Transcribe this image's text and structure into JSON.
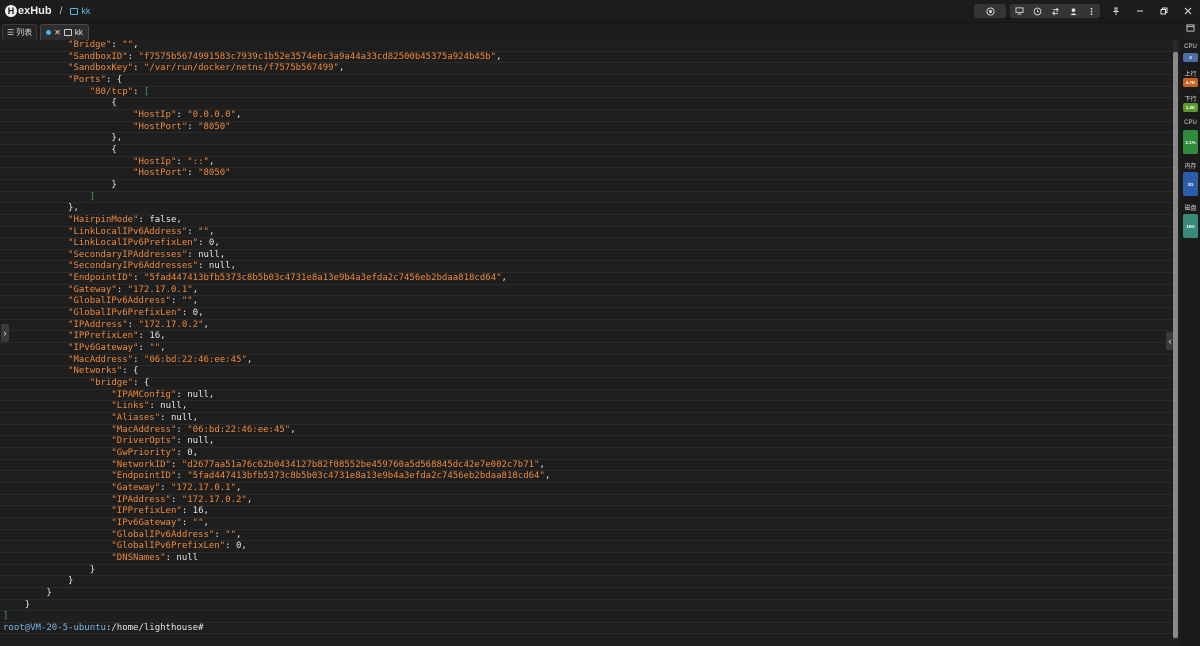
{
  "app": {
    "logo_letter": "H",
    "title": "exHub",
    "breadcrumb_sep": "/",
    "breadcrumb_item": "kk"
  },
  "tabs": {
    "list_label": "列表",
    "active_close": "✕",
    "active_label": "kk"
  },
  "terminal_lines": [
    {
      "indent": 12,
      "segs": [
        [
          "k",
          "\"Bridge\""
        ],
        [
          "p",
          ": "
        ],
        [
          "s",
          "\"\""
        ],
        [
          "p",
          ","
        ]
      ]
    },
    {
      "indent": 12,
      "segs": [
        [
          "k",
          "\"SandboxID\""
        ],
        [
          "p",
          ": "
        ],
        [
          "s",
          "\"f7575b5674991583c7939c1b52e3574ebc3a9a44a33cd82500b45375a924b45b\""
        ],
        [
          "p",
          ","
        ]
      ]
    },
    {
      "indent": 12,
      "segs": [
        [
          "k",
          "\"SandboxKey\""
        ],
        [
          "p",
          ": "
        ],
        [
          "s",
          "\"/var/run/docker/netns/f7575b567499\""
        ],
        [
          "p",
          ","
        ]
      ]
    },
    {
      "indent": 12,
      "segs": [
        [
          "k",
          "\"Ports\""
        ],
        [
          "p",
          ": {"
        ]
      ]
    },
    {
      "indent": 16,
      "segs": [
        [
          "k",
          "\"80/tcp\""
        ],
        [
          "p",
          ": "
        ],
        [
          "g",
          "["
        ]
      ]
    },
    {
      "indent": 20,
      "segs": [
        [
          "p",
          "{"
        ]
      ]
    },
    {
      "indent": 24,
      "segs": [
        [
          "k",
          "\"HostIp\""
        ],
        [
          "p",
          ": "
        ],
        [
          "s",
          "\"0.0.0.0\""
        ],
        [
          "p",
          ","
        ]
      ]
    },
    {
      "indent": 24,
      "segs": [
        [
          "k",
          "\"HostPort\""
        ],
        [
          "p",
          ": "
        ],
        [
          "s",
          "\"8050\""
        ]
      ]
    },
    {
      "indent": 20,
      "segs": [
        [
          "p",
          "},"
        ]
      ]
    },
    {
      "indent": 20,
      "segs": [
        [
          "p",
          "{"
        ]
      ]
    },
    {
      "indent": 24,
      "segs": [
        [
          "k",
          "\"HostIp\""
        ],
        [
          "p",
          ": "
        ],
        [
          "s",
          "\"::\""
        ],
        [
          "p",
          ","
        ]
      ]
    },
    {
      "indent": 24,
      "segs": [
        [
          "k",
          "\"HostPort\""
        ],
        [
          "p",
          ": "
        ],
        [
          "s",
          "\"8050\""
        ]
      ]
    },
    {
      "indent": 20,
      "segs": [
        [
          "p",
          "}"
        ]
      ]
    },
    {
      "indent": 16,
      "segs": [
        [
          "g",
          "]"
        ]
      ]
    },
    {
      "indent": 12,
      "segs": [
        [
          "p",
          "},"
        ]
      ]
    },
    {
      "indent": 12,
      "segs": [
        [
          "k",
          "\"HairpinMode\""
        ],
        [
          "p",
          ": false,"
        ]
      ]
    },
    {
      "indent": 12,
      "segs": [
        [
          "k",
          "\"LinkLocalIPv6Address\""
        ],
        [
          "p",
          ": "
        ],
        [
          "s",
          "\"\""
        ],
        [
          "p",
          ","
        ]
      ]
    },
    {
      "indent": 12,
      "segs": [
        [
          "k",
          "\"LinkLocalIPv6PrefixLen\""
        ],
        [
          "p",
          ": 0,"
        ]
      ]
    },
    {
      "indent": 12,
      "segs": [
        [
          "k",
          "\"SecondaryIPAddresses\""
        ],
        [
          "p",
          ": null,"
        ]
      ]
    },
    {
      "indent": 12,
      "segs": [
        [
          "k",
          "\"SecondaryIPv6Addresses\""
        ],
        [
          "p",
          ": null,"
        ]
      ]
    },
    {
      "indent": 12,
      "segs": [
        [
          "k",
          "\"EndpointID\""
        ],
        [
          "p",
          ": "
        ],
        [
          "s",
          "\"5fad447413bfb5373c8b5b03c4731e8a13e9b4a3efda2c7456eb2bdaa818cd64\""
        ],
        [
          "p",
          ","
        ]
      ]
    },
    {
      "indent": 12,
      "segs": [
        [
          "k",
          "\"Gateway\""
        ],
        [
          "p",
          ": "
        ],
        [
          "s",
          "\"172.17.0.1\""
        ],
        [
          "p",
          ","
        ]
      ]
    },
    {
      "indent": 12,
      "segs": [
        [
          "k",
          "\"GlobalIPv6Address\""
        ],
        [
          "p",
          ": "
        ],
        [
          "s",
          "\"\""
        ],
        [
          "p",
          ","
        ]
      ]
    },
    {
      "indent": 12,
      "segs": [
        [
          "k",
          "\"GlobalIPv6PrefixLen\""
        ],
        [
          "p",
          ": 0,"
        ]
      ]
    },
    {
      "indent": 12,
      "segs": [
        [
          "k",
          "\"IPAddress\""
        ],
        [
          "p",
          ": "
        ],
        [
          "s",
          "\"172.17.0.2\""
        ],
        [
          "p",
          ","
        ]
      ]
    },
    {
      "indent": 12,
      "segs": [
        [
          "k",
          "\"IPPrefixLen\""
        ],
        [
          "p",
          ": 16,"
        ]
      ]
    },
    {
      "indent": 12,
      "segs": [
        [
          "k",
          "\"IPv6Gateway\""
        ],
        [
          "p",
          ": "
        ],
        [
          "s",
          "\"\""
        ],
        [
          "p",
          ","
        ]
      ]
    },
    {
      "indent": 12,
      "segs": [
        [
          "k",
          "\"MacAddress\""
        ],
        [
          "p",
          ": "
        ],
        [
          "s",
          "\"06:bd:22:46:ee:45\""
        ],
        [
          "p",
          ","
        ]
      ]
    },
    {
      "indent": 12,
      "segs": [
        [
          "k",
          "\"Networks\""
        ],
        [
          "p",
          ": {"
        ]
      ]
    },
    {
      "indent": 16,
      "segs": [
        [
          "k",
          "\"bridge\""
        ],
        [
          "p",
          ": {"
        ]
      ]
    },
    {
      "indent": 20,
      "segs": [
        [
          "k",
          "\"IPAMConfig\""
        ],
        [
          "p",
          ": null,"
        ]
      ]
    },
    {
      "indent": 20,
      "segs": [
        [
          "k",
          "\"Links\""
        ],
        [
          "p",
          ": null,"
        ]
      ]
    },
    {
      "indent": 20,
      "segs": [
        [
          "k",
          "\"Aliases\""
        ],
        [
          "p",
          ": null,"
        ]
      ]
    },
    {
      "indent": 20,
      "segs": [
        [
          "k",
          "\"MacAddress\""
        ],
        [
          "p",
          ": "
        ],
        [
          "s",
          "\"06:bd:22:46:ee:45\""
        ],
        [
          "p",
          ","
        ]
      ]
    },
    {
      "indent": 20,
      "segs": [
        [
          "k",
          "\"DriverOpts\""
        ],
        [
          "p",
          ": null,"
        ]
      ]
    },
    {
      "indent": 20,
      "segs": [
        [
          "k",
          "\"GwPriority\""
        ],
        [
          "p",
          ": 0,"
        ]
      ]
    },
    {
      "indent": 20,
      "segs": [
        [
          "k",
          "\"NetworkID\""
        ],
        [
          "p",
          ": "
        ],
        [
          "s",
          "\"d2677aa51a76c62b0434127b82f08552be459760a5d568845dc42e7e002c7b71\""
        ],
        [
          "p",
          ","
        ]
      ]
    },
    {
      "indent": 20,
      "segs": [
        [
          "k",
          "\"EndpointID\""
        ],
        [
          "p",
          ": "
        ],
        [
          "s",
          "\"5fad447413bfb5373c8b5b03c4731e8a13e9b4a3efda2c7456eb2bdaa818cd64\""
        ],
        [
          "p",
          ","
        ]
      ]
    },
    {
      "indent": 20,
      "segs": [
        [
          "k",
          "\"Gateway\""
        ],
        [
          "p",
          ": "
        ],
        [
          "s",
          "\"172.17.0.1\""
        ],
        [
          "p",
          ","
        ]
      ]
    },
    {
      "indent": 20,
      "segs": [
        [
          "k",
          "\"IPAddress\""
        ],
        [
          "p",
          ": "
        ],
        [
          "s",
          "\"172.17.0.2\""
        ],
        [
          "p",
          ","
        ]
      ]
    },
    {
      "indent": 20,
      "segs": [
        [
          "k",
          "\"IPPrefixLen\""
        ],
        [
          "p",
          ": 16,"
        ]
      ]
    },
    {
      "indent": 20,
      "segs": [
        [
          "k",
          "\"IPv6Gateway\""
        ],
        [
          "p",
          ": "
        ],
        [
          "s",
          "\"\""
        ],
        [
          "p",
          ","
        ]
      ]
    },
    {
      "indent": 20,
      "segs": [
        [
          "k",
          "\"GlobalIPv6Address\""
        ],
        [
          "p",
          ": "
        ],
        [
          "s",
          "\"\""
        ],
        [
          "p",
          ","
        ]
      ]
    },
    {
      "indent": 20,
      "segs": [
        [
          "k",
          "\"GlobalIPv6PrefixLen\""
        ],
        [
          "p",
          ": 0,"
        ]
      ]
    },
    {
      "indent": 20,
      "segs": [
        [
          "k",
          "\"DNSNames\""
        ],
        [
          "p",
          ": null"
        ]
      ]
    },
    {
      "indent": 16,
      "segs": [
        [
          "p",
          "}"
        ]
      ]
    },
    {
      "indent": 12,
      "segs": [
        [
          "p",
          "}"
        ]
      ]
    },
    {
      "indent": 8,
      "segs": [
        [
          "p",
          "}"
        ]
      ]
    },
    {
      "indent": 4,
      "segs": [
        [
          "p",
          "}"
        ]
      ]
    },
    {
      "indent": 0,
      "segs": [
        [
          "g",
          "]"
        ]
      ]
    }
  ],
  "prompt": {
    "user_host": "root@VM-20-5-ubuntu",
    "path": ":/home/lighthouse#"
  },
  "stats": [
    {
      "label": "CPU",
      "value": "4",
      "color": "#4a6fa5"
    },
    {
      "label": "上行",
      "value": "4.7K",
      "color": "#c8641e"
    },
    {
      "label": "下行",
      "value": "1.3K",
      "color": "#5a9a2a"
    },
    {
      "label": "CPU",
      "value": "2.1%",
      "color": "#2e8b3a"
    },
    {
      "label": "内存",
      "value": "3G",
      "color": "#2a5ea8"
    },
    {
      "label": "磁盘",
      "value": "19G",
      "color": "#3a8a7a"
    }
  ],
  "scroll_position": 0.85
}
